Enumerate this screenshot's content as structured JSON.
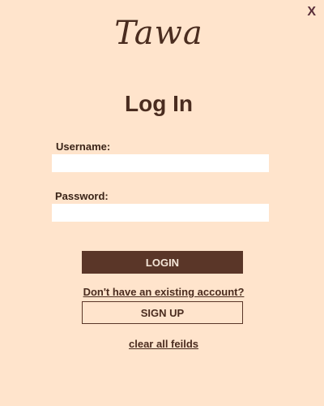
{
  "window": {
    "close_label": "X"
  },
  "brand": {
    "name": "Tawa"
  },
  "form": {
    "title": "Log In",
    "username_label": "Username:",
    "username_value": "",
    "password_label": "Password:",
    "password_value": "",
    "login_label": "LOGIN",
    "no_account_text": "Don't have an existing account?",
    "signup_label": "SIGN UP",
    "clear_label": "clear all feilds"
  },
  "colors": {
    "background": "#FFE4CC",
    "primary": "#5A3628",
    "text": "#4A2C1F",
    "close": "#5A2F3A"
  }
}
